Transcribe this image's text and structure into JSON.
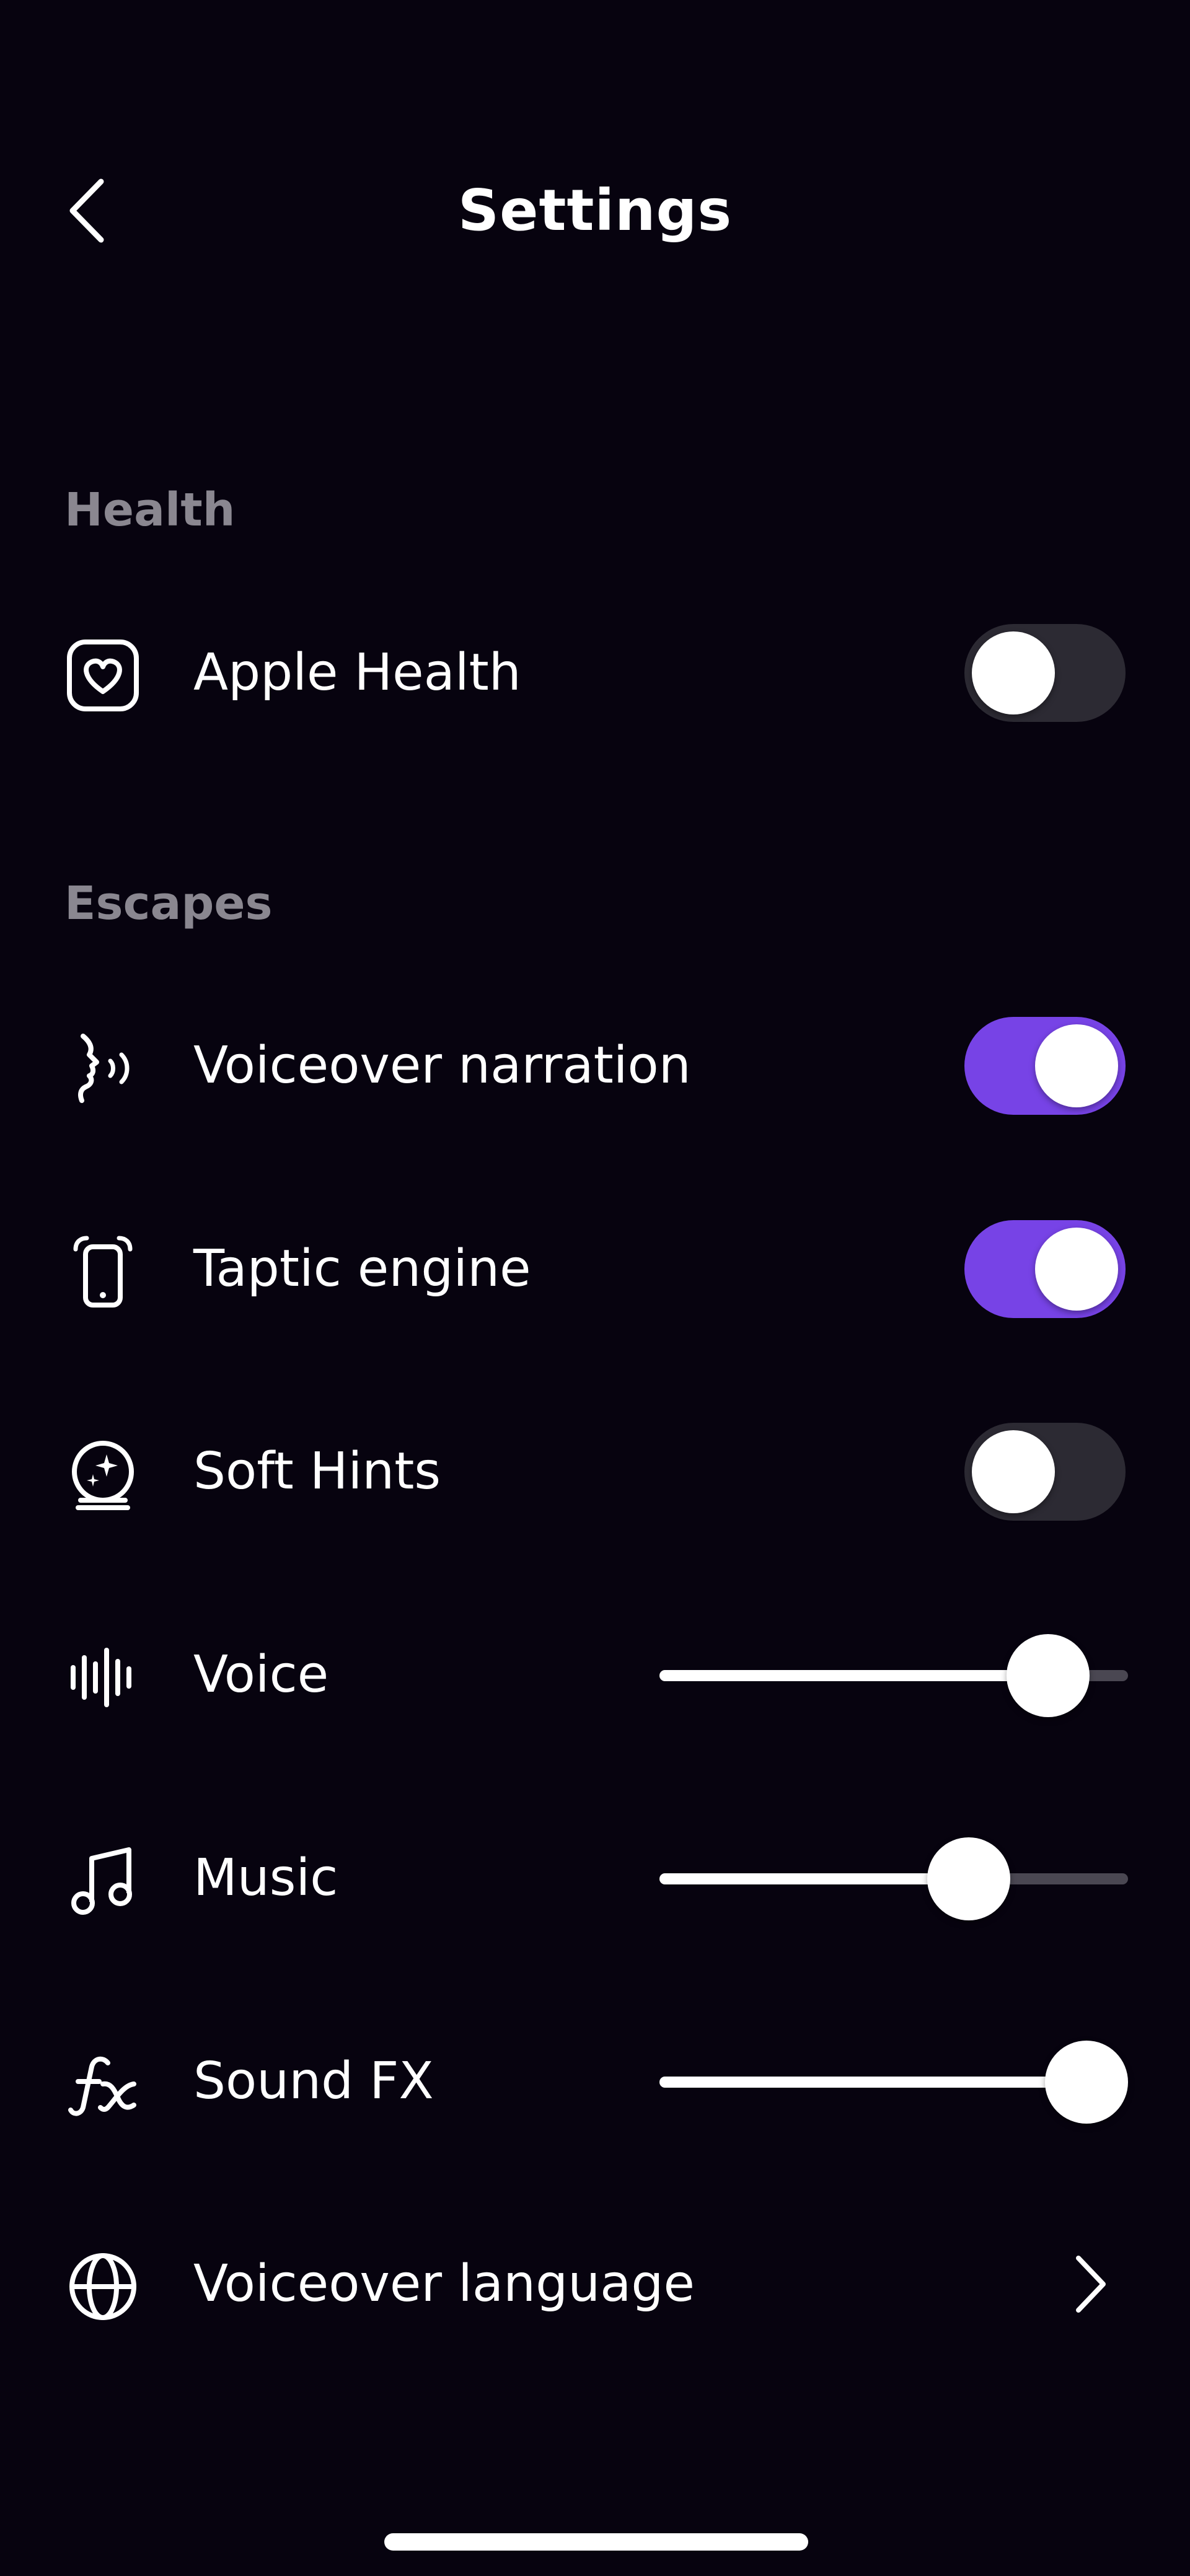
{
  "header": {
    "title": "Settings",
    "back_icon": "chevron-left-icon"
  },
  "sections": {
    "health": {
      "label": "Health",
      "apple_health": {
        "label": "Apple Health",
        "icon": "heart-square-icon",
        "enabled": false
      }
    },
    "escapes": {
      "label": "Escapes",
      "voiceover_narration": {
        "label": "Voiceover narration",
        "icon": "speaking-head-icon",
        "enabled": true
      },
      "taptic_engine": {
        "label": "Taptic engine",
        "icon": "vibrating-phone-icon",
        "enabled": true
      },
      "soft_hints": {
        "label": "Soft Hints",
        "icon": "crystal-ball-icon",
        "enabled": false
      },
      "voice": {
        "label": "Voice",
        "icon": "waveform-icon",
        "level": 0.83
      },
      "music": {
        "label": "Music",
        "icon": "music-note-icon",
        "level": 0.66
      },
      "sound_fx": {
        "label": "Sound FX",
        "icon": "fx-icon",
        "level": 1.0
      },
      "voiceover_language": {
        "label": "Voiceover language",
        "icon": "globe-icon"
      }
    }
  },
  "colors": {
    "background": "#07030f",
    "accent": "#7743e6",
    "toggle_off": "#2c2a33",
    "section_label": "#8a8790"
  }
}
